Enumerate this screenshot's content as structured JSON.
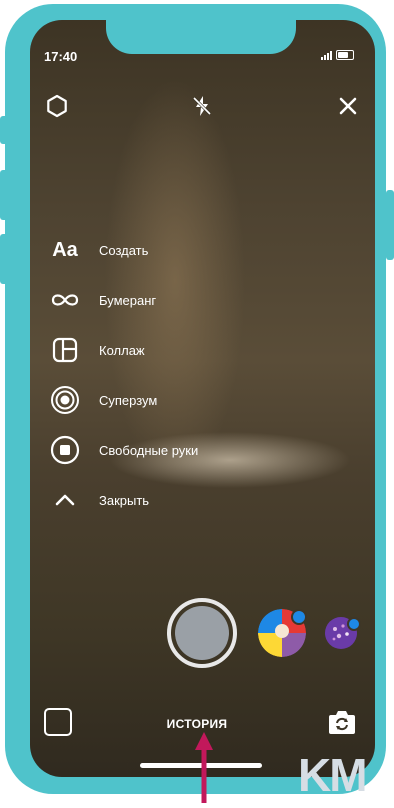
{
  "status_bar": {
    "time": "17:40"
  },
  "top_bar": {
    "settings_icon": "gear-icon",
    "flash_icon": "flash-off-icon",
    "close_icon": "close-icon"
  },
  "menu": {
    "items": [
      {
        "label": "Создать",
        "icon": "text-aa-icon"
      },
      {
        "label": "Бумеранг",
        "icon": "infinity-icon"
      },
      {
        "label": "Коллаж",
        "icon": "layout-icon"
      },
      {
        "label": "Суперзум",
        "icon": "superzoom-icon"
      },
      {
        "label": "Свободные руки",
        "icon": "hands-free-icon"
      },
      {
        "label": "Закрыть",
        "icon": "chevron-up-icon"
      }
    ],
    "icon_text": "Aa"
  },
  "bottom": {
    "mode_label": "ИСТОРИЯ"
  },
  "watermark": "KM",
  "colors": {
    "frame": "#4fc3cb",
    "arrow": "#c2185b",
    "effect_purple": "#6a3ba8"
  }
}
